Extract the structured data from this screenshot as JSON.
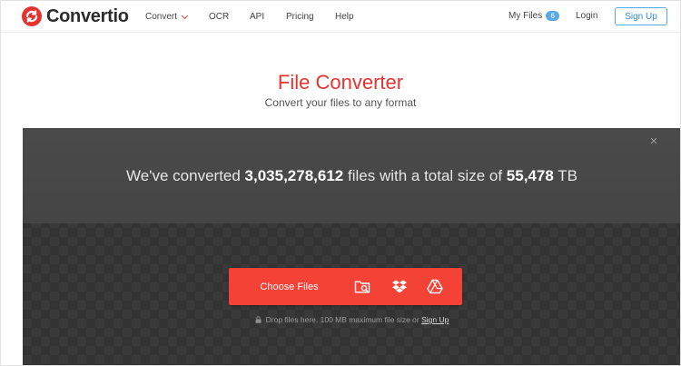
{
  "brand": {
    "name": "Convertio",
    "color": "#e8322f"
  },
  "nav": {
    "convert": "Convert",
    "ocr": "OCR",
    "api": "API",
    "pricing": "Pricing",
    "help": "Help"
  },
  "account": {
    "my_files": "My Files",
    "my_files_count": "6",
    "login": "Login",
    "sign_up": "Sign Up"
  },
  "hero": {
    "title": "File Converter",
    "subtitle": "Convert your files to any format"
  },
  "stats": {
    "prefix": "We've converted ",
    "files_count": "3,035,278,612",
    "middle": " files with a total size of ",
    "total_size": "55,478",
    "unit": " TB"
  },
  "upload": {
    "choose_files": "Choose Files",
    "sources": [
      "folder-search-icon",
      "dropbox-icon",
      "google-drive-icon"
    ],
    "drop_note": "Drop files here. 100 MB maximum file size or ",
    "drop_note_link": "Sign Up"
  },
  "colors": {
    "accent_red": "#f44336",
    "badge_blue": "#5aa9e6",
    "panel_dark": "#333333"
  }
}
